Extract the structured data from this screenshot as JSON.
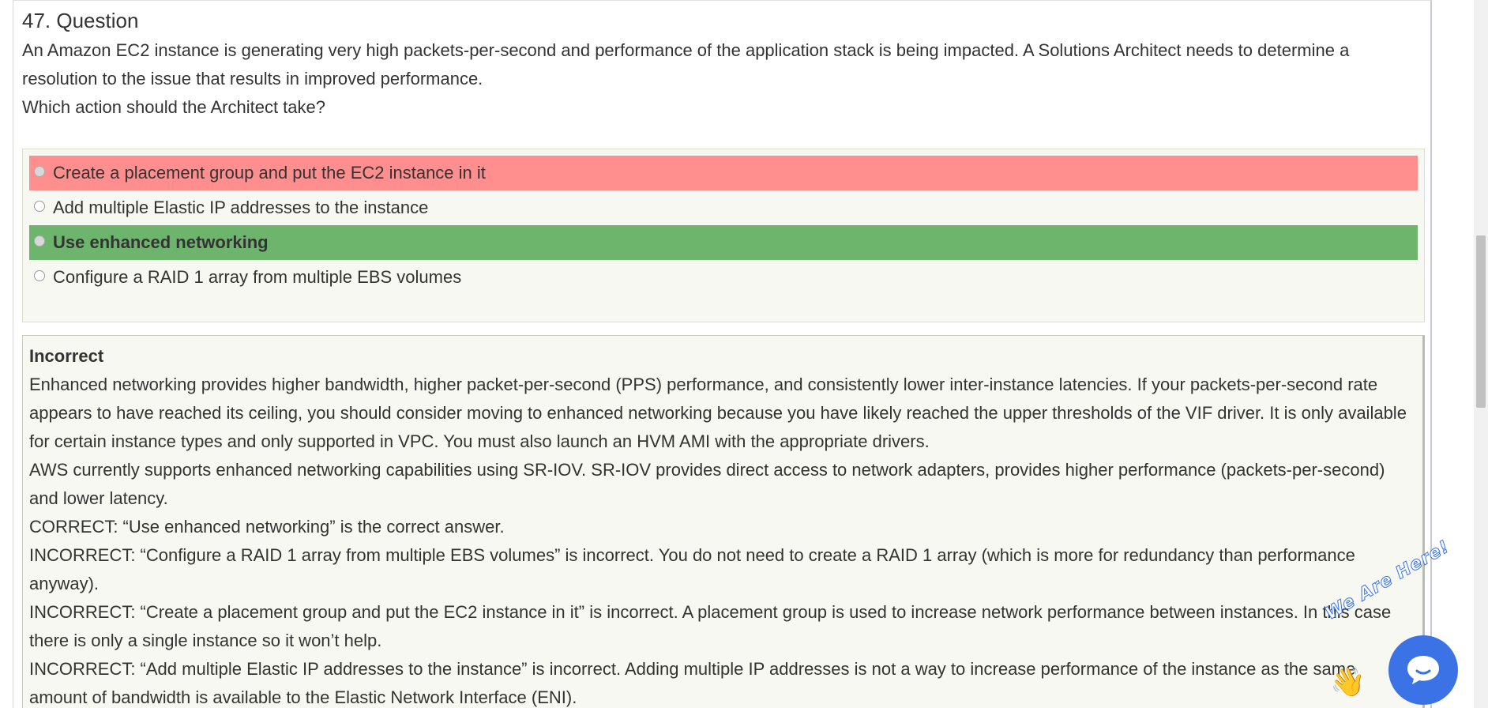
{
  "question": {
    "title": "47. Question",
    "lines": [
      "An Amazon EC2 instance is generating very high packets-per-second and performance of the application stack is being impacted. A Solutions Architect needs to determine a resolution to the issue that results in improved performance.",
      "Which action should the Architect take?"
    ]
  },
  "answers": [
    {
      "label": "Create a placement group and put the EC2 instance in it",
      "state": "incorrect"
    },
    {
      "label": "Add multiple Elastic IP addresses to the instance",
      "state": "neutral"
    },
    {
      "label": "Use enhanced networking",
      "state": "correct"
    },
    {
      "label": "Configure a RAID 1 array from multiple EBS volumes",
      "state": "neutral"
    }
  ],
  "explanation": {
    "status": "Incorrect",
    "paragraphs": [
      "Enhanced networking provides higher bandwidth, higher packet-per-second (PPS) performance, and consistently lower inter-instance latencies. If your packets-per-second rate appears to have reached its ceiling, you should consider moving to enhanced networking because you have likely reached the upper thresholds of the VIF driver. It is only available for certain instance types and only supported in VPC. You must also launch an HVM AMI with the appropriate drivers.",
      "AWS currently supports enhanced networking capabilities using SR-IOV. SR-IOV provides direct access to network adapters, provides higher performance (packets-per-second) and lower latency.",
      "CORRECT: “Use enhanced networking” is the correct answer.",
      "INCORRECT: “Configure a RAID 1 array from multiple EBS volumes” is incorrect. You do not need to create a RAID 1 array (which is more for redundancy than performance anyway).",
      "INCORRECT: “Create a placement group and put the EC2 instance in it” is incorrect. A placement group is used to increase network performance between instances. In this case there is only a single instance so it won’t help.",
      "INCORRECT: “Add multiple Elastic IP addresses to the instance” is incorrect. Adding multiple IP addresses is not a way to increase performance of the instance as the same amount of bandwidth is available to the Elastic Network Interface (ENI)."
    ]
  },
  "chat_widget": {
    "banner_text": "We Are Here!",
    "icon": "chat-bubble-icon",
    "hand_icon": "waving-hand-icon",
    "color": "#3b73e6"
  },
  "colors": {
    "incorrect_bg": "#ff8f8f",
    "correct_bg": "#6db56d",
    "panel_bg": "#f6f8f1"
  }
}
